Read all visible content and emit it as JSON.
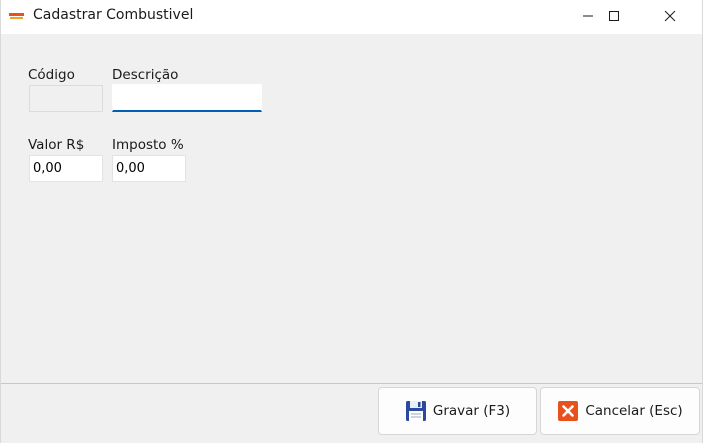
{
  "window": {
    "title": "Cadastrar Combustivel",
    "app_icon_name": "app-logo-icon",
    "controls": [
      "minimize-icon",
      "maximize-icon",
      "close-icon"
    ]
  },
  "form": {
    "codigo": {
      "label": "Código",
      "value": ""
    },
    "descricao": {
      "label": "Descrição",
      "value": ""
    },
    "valor": {
      "label": "Valor R$",
      "value": "0,00"
    },
    "imposto": {
      "label": "Imposto %",
      "value": "0,00"
    }
  },
  "actions": {
    "save_label": "Gravar (F3)",
    "save_icon": "floppy-disk-icon",
    "cancel_label": "Cancelar (Esc)",
    "cancel_icon": "red-x-icon"
  },
  "colors": {
    "focus_underline": "#005fb8",
    "window_background": "#f0f0f0",
    "titlebar_background": "#ffffff",
    "cancel_icon": "#e8501c",
    "save_icon": "#2b4a9c"
  }
}
